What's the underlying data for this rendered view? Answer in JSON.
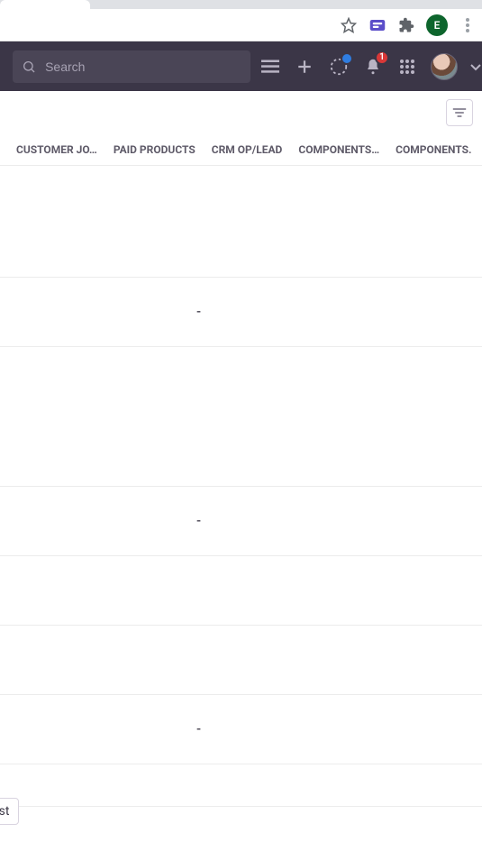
{
  "browser": {
    "profile_initial": "E"
  },
  "header": {
    "search_placeholder": "Search",
    "notifications_count": "1"
  },
  "columns": [
    "CUSTOMER JO…",
    "PAID PRODUCTS",
    "CRM OP/LEAD",
    "COMPONENTS…",
    "COMPONENTS."
  ],
  "rows": [
    {
      "value": ""
    },
    {
      "value": ""
    },
    {
      "value": "-"
    },
    {
      "value": ""
    },
    {
      "value": ""
    },
    {
      "value": "-"
    },
    {
      "value": ""
    },
    {
      "value": ""
    },
    {
      "value": "-"
    },
    {
      "value": ""
    }
  ],
  "footer": {
    "button_label_fragment": "ast"
  }
}
